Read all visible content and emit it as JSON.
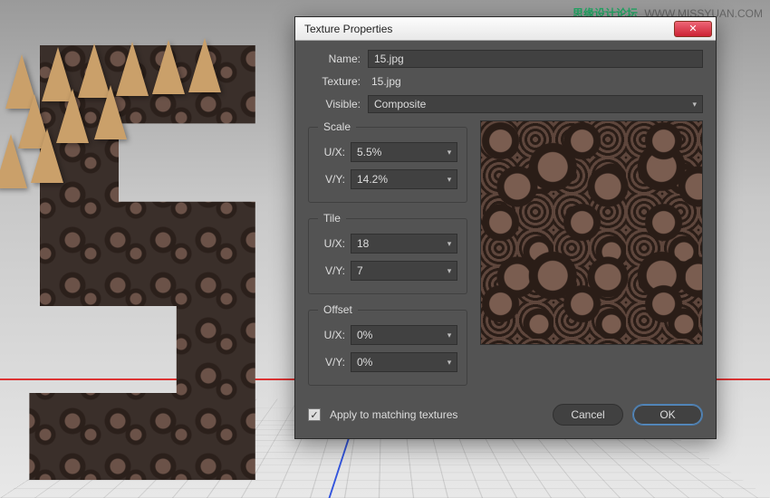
{
  "watermark": {
    "badge": "思缘设计论坛",
    "url": "WWW.MISSYUAN.COM"
  },
  "dialog": {
    "title": "Texture Properties",
    "name_label": "Name:",
    "name_value": "15.jpg",
    "texture_label": "Texture:",
    "texture_value": "15.jpg",
    "visible_label": "Visible:",
    "visible_value": "Composite",
    "scale": {
      "legend": "Scale",
      "ux_label": "U/X:",
      "ux_value": "5.5%",
      "vy_label": "V/Y:",
      "vy_value": "14.2%"
    },
    "tile": {
      "legend": "Tile",
      "ux_label": "U/X:",
      "ux_value": "18",
      "vy_label": "V/Y:",
      "vy_value": "7"
    },
    "offset": {
      "legend": "Offset",
      "ux_label": "U/X:",
      "ux_value": "0%",
      "vy_label": "V/Y:",
      "vy_value": "0%"
    },
    "apply_checked": true,
    "apply_label": "Apply to matching textures",
    "cancel": "Cancel",
    "ok": "OK"
  }
}
